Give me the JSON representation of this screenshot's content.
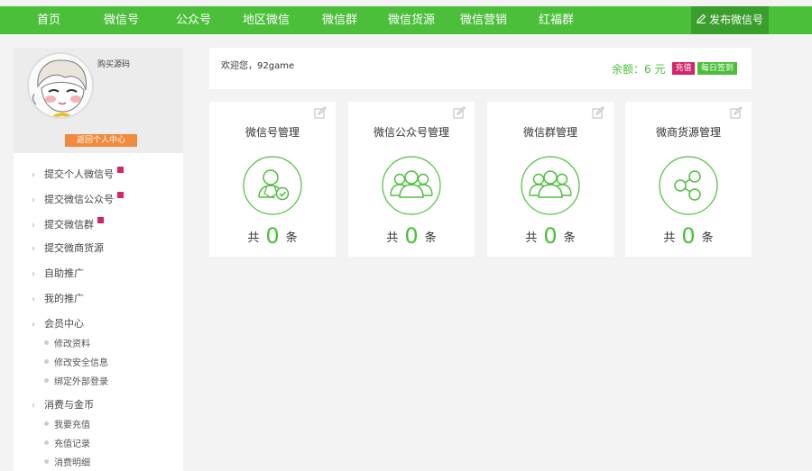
{
  "nav": {
    "items": [
      "首页",
      "微信号",
      "公众号",
      "地区微信",
      "微信群",
      "微信货源",
      "微信营销",
      "红福群"
    ],
    "publish_label": "发布微信号"
  },
  "profile": {
    "buy_code_label": "购买源码",
    "return_label": "返回个人中心"
  },
  "sidebar": {
    "items": [
      {
        "label": "提交个人微信号",
        "tag": true
      },
      {
        "label": "提交微信公众号",
        "tag": true
      },
      {
        "label": "提交微信群",
        "tag": true
      },
      {
        "label": "提交微商货源",
        "tag": false
      },
      {
        "label": "自助推广",
        "tag": false
      },
      {
        "label": "我的推广",
        "tag": false
      },
      {
        "label": "会员中心",
        "tag": false
      },
      {
        "label": "消费与金币",
        "tag": false
      }
    ],
    "member_sub": [
      "修改资料",
      "修改安全信息",
      "绑定外部登录"
    ],
    "consume_sub": [
      "我要充值",
      "充值记录",
      "消费明细"
    ]
  },
  "welcome": {
    "text": "欢迎您，92game",
    "balance_label": "余额：6 元",
    "recharge_label": "充值",
    "signin_label": "每日签到"
  },
  "cards": [
    {
      "title": "微信号管理",
      "icon": "person-check-icon",
      "prefix": "共",
      "count": "0",
      "suffix": "条"
    },
    {
      "title": "微信公众号管理",
      "icon": "group-icon",
      "prefix": "共",
      "count": "0",
      "suffix": "条"
    },
    {
      "title": "微信群管理",
      "icon": "group-icon",
      "prefix": "共",
      "count": "0",
      "suffix": "条"
    },
    {
      "title": "微商货源管理",
      "icon": "share-nodes-icon",
      "prefix": "共",
      "count": "0",
      "suffix": "条"
    }
  ],
  "colors": {
    "brand_green": "#4bbf3a",
    "dark_green": "#3a9e2c",
    "accent_pink": "#d6246a",
    "accent_orange": "#f08a3e"
  }
}
